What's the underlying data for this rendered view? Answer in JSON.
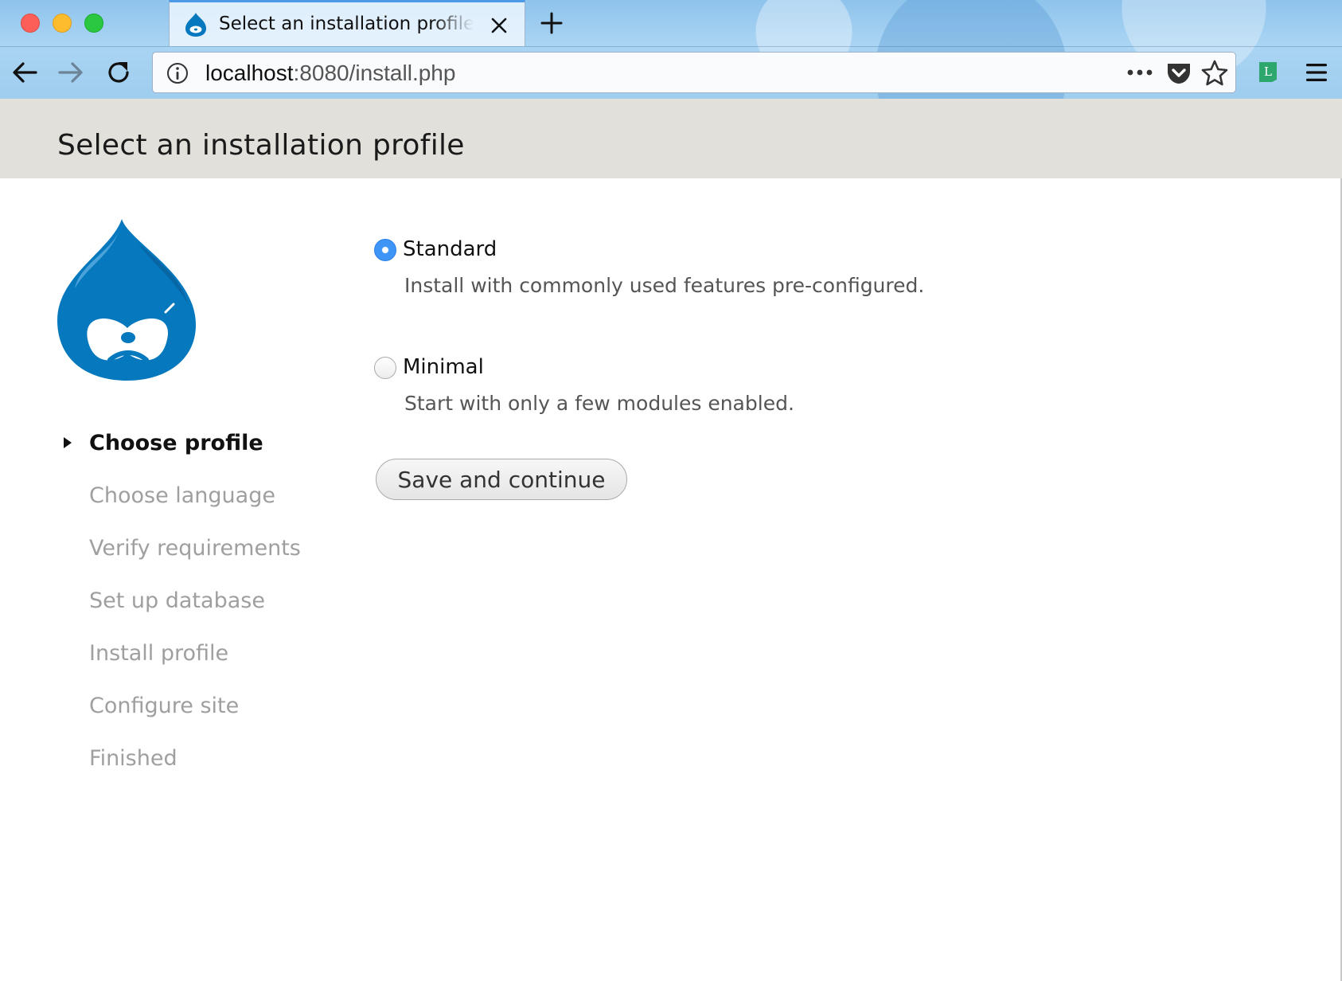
{
  "browser": {
    "tab_title": "Select an installation profile | Drupal",
    "url_host": "localhost",
    "url_rest": ":8080/install.php",
    "ext_letter": "L",
    "accent_color": "#3e95f5"
  },
  "page": {
    "title": "Select an installation profile",
    "logo": "drupal-drop-logo"
  },
  "steps": [
    {
      "label": "Choose profile",
      "active": true
    },
    {
      "label": "Choose language",
      "active": false
    },
    {
      "label": "Verify requirements",
      "active": false
    },
    {
      "label": "Set up database",
      "active": false
    },
    {
      "label": "Install profile",
      "active": false
    },
    {
      "label": "Configure site",
      "active": false
    },
    {
      "label": "Finished",
      "active": false
    }
  ],
  "profiles": [
    {
      "label": "Standard",
      "description": "Install with commonly used features pre-configured.",
      "checked": true
    },
    {
      "label": "Minimal",
      "description": "Start with only a few modules enabled.",
      "checked": false
    }
  ],
  "submit_label": "Save and continue"
}
